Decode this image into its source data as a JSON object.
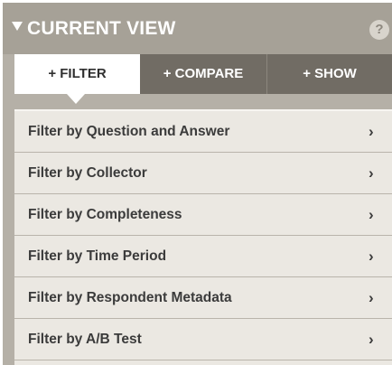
{
  "header": {
    "title": "CURRENT VIEW",
    "help_label": "?"
  },
  "tabs": [
    {
      "label": "+ FILTER",
      "active": true
    },
    {
      "label": "+ COMPARE",
      "active": false
    },
    {
      "label": "+ SHOW",
      "active": false
    }
  ],
  "filters": [
    {
      "label": "Filter by Question and Answer",
      "chevron": "›"
    },
    {
      "label": "Filter by Collector",
      "chevron": "›"
    },
    {
      "label": "Filter by Completeness",
      "chevron": "›"
    },
    {
      "label": "Filter by Time Period",
      "chevron": "›"
    },
    {
      "label": "Filter by Respondent Metadata",
      "chevron": "›"
    },
    {
      "label": "Filter by A/B Test",
      "chevron": "›"
    }
  ],
  "colors": {
    "panel_bg": "#a6a197",
    "tab_active_bg": "#ffffff",
    "tab_inactive_bg": "#716c64",
    "list_bg": "#ebe8e2"
  }
}
